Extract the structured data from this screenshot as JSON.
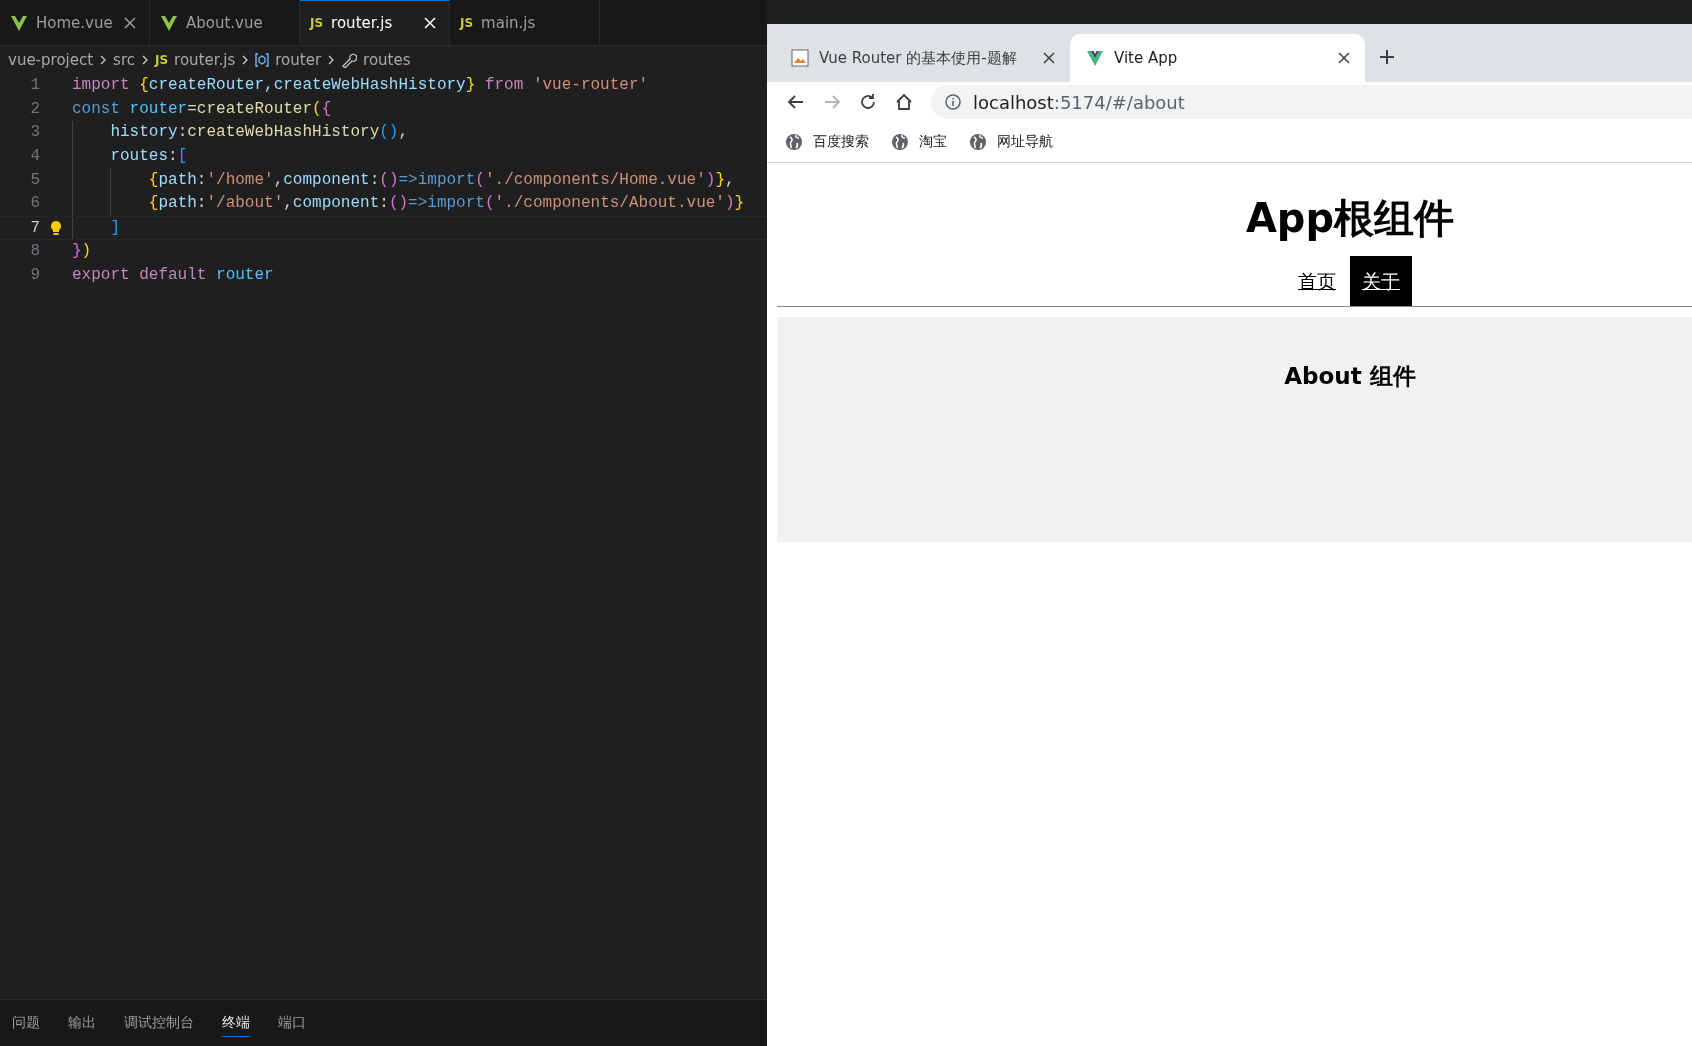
{
  "editor": {
    "tabs": [
      {
        "label": "Home.vue",
        "selected": false,
        "close": true
      },
      {
        "label": "About.vue",
        "selected": false,
        "close": false
      },
      {
        "label": "router.js",
        "badge": "JS",
        "selected": true,
        "close": true
      },
      {
        "label": "main.js",
        "badge": "JS",
        "selected": false,
        "close": false
      }
    ],
    "breadcrumb": [
      {
        "label": "vue-project"
      },
      {
        "label": "src"
      },
      {
        "label": "router.js",
        "badge": "JS"
      },
      {
        "label": "router"
      },
      {
        "label": "routes"
      }
    ],
    "lines": [
      {
        "number": "1",
        "current": false,
        "tokens": [
          {
            "kind": "keyword",
            "text": "import "
          },
          {
            "kind": "bracket1",
            "text": "{"
          },
          {
            "kind": "property",
            "text": "createRouter,createWebHashHistory"
          },
          {
            "kind": "bracket1",
            "text": "}"
          },
          {
            "kind": "keyword",
            "text": " from "
          },
          {
            "kind": "string",
            "text": "'vue-router'"
          }
        ]
      },
      {
        "number": "2",
        "current": false,
        "tokens": [
          {
            "kind": "storage",
            "text": "const "
          },
          {
            "kind": "variable",
            "text": "router"
          },
          {
            "kind": "punct",
            "text": "="
          },
          {
            "kind": "function",
            "text": "createRouter"
          },
          {
            "kind": "bracket1",
            "text": "("
          },
          {
            "kind": "bracket2",
            "text": "{"
          }
        ]
      },
      {
        "number": "3",
        "current": false,
        "tokens": [
          {
            "kind": "property",
            "text": "    history"
          },
          {
            "kind": "punct",
            "text": ":"
          },
          {
            "kind": "function",
            "text": "createWebHashHistory"
          },
          {
            "kind": "bracket3",
            "text": "()"
          },
          {
            "kind": "punct",
            "text": ","
          }
        ]
      },
      {
        "number": "4",
        "current": false,
        "tokens": [
          {
            "kind": "property",
            "text": "    routes"
          },
          {
            "kind": "punct",
            "text": ":"
          },
          {
            "kind": "bracket3",
            "text": "["
          }
        ]
      },
      {
        "number": "5",
        "current": false,
        "tokens": [
          {
            "kind": "bracket1",
            "text": "        {"
          },
          {
            "kind": "property",
            "text": "path"
          },
          {
            "kind": "punct",
            "text": ":"
          },
          {
            "kind": "string",
            "text": "'/home'"
          },
          {
            "kind": "punct",
            "text": ","
          },
          {
            "kind": "property",
            "text": "component"
          },
          {
            "kind": "punct",
            "text": ":"
          },
          {
            "kind": "bracket2",
            "text": "()"
          },
          {
            "kind": "storage",
            "text": "=>import"
          },
          {
            "kind": "bracket2",
            "text": "("
          },
          {
            "kind": "string",
            "text": "'./components/Home.vue'"
          },
          {
            "kind": "bracket2",
            "text": ")"
          },
          {
            "kind": "bracket1",
            "text": "}"
          },
          {
            "kind": "punct",
            "text": ","
          }
        ]
      },
      {
        "number": "6",
        "current": false,
        "tokens": [
          {
            "kind": "bracket1",
            "text": "        {"
          },
          {
            "kind": "property",
            "text": "path"
          },
          {
            "kind": "punct",
            "text": ":"
          },
          {
            "kind": "string",
            "text": "'/about'"
          },
          {
            "kind": "punct",
            "text": ","
          },
          {
            "kind": "property",
            "text": "component"
          },
          {
            "kind": "punct",
            "text": ":"
          },
          {
            "kind": "bracket2",
            "text": "()"
          },
          {
            "kind": "storage",
            "text": "=>import"
          },
          {
            "kind": "bracket2",
            "text": "("
          },
          {
            "kind": "string",
            "text": "'./components/About.vue'"
          },
          {
            "kind": "bracket2",
            "text": ")"
          },
          {
            "kind": "bracket1",
            "text": "}"
          }
        ]
      },
      {
        "number": "7",
        "current": true,
        "lightbulb": true,
        "tokens": [
          {
            "kind": "bracket3",
            "text": "    ]"
          }
        ]
      },
      {
        "number": "8",
        "current": false,
        "tokens": [
          {
            "kind": "bracket2",
            "text": "}"
          },
          {
            "kind": "bracket1",
            "text": ")"
          }
        ]
      },
      {
        "number": "9",
        "current": false,
        "tokens": [
          {
            "kind": "keyword",
            "text": "export default "
          },
          {
            "kind": "variable",
            "text": "router"
          }
        ]
      }
    ],
    "panel_tabs": [
      {
        "label": "问题",
        "selected": false
      },
      {
        "label": "输出",
        "selected": false
      },
      {
        "label": "调试控制台",
        "selected": false
      },
      {
        "label": "终端",
        "selected": true
      },
      {
        "label": "端口",
        "selected": false
      }
    ]
  },
  "browser": {
    "tabs": [
      {
        "title": "Vue Router 的基本使用-题解",
        "selected": false
      },
      {
        "title": "Vite App",
        "selected": true
      }
    ],
    "address": {
      "host": "localhost",
      "rest": ":5174/#/about"
    },
    "bookmarks": [
      {
        "label": "百度搜索"
      },
      {
        "label": "淘宝"
      },
      {
        "label": "网址导航"
      }
    ],
    "page": {
      "heading": "App根组件",
      "nav": [
        {
          "label": "首页",
          "selected": false
        },
        {
          "label": "关于",
          "selected": true
        }
      ],
      "view_heading": "About 组件"
    }
  }
}
